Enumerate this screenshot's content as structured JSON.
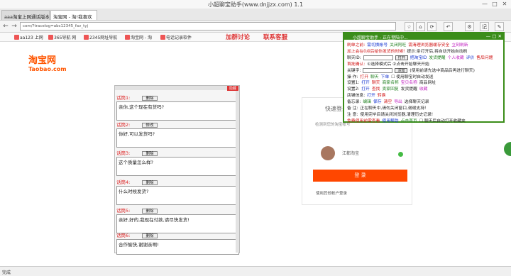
{
  "window": {
    "title": "小超聊宝助手(www.dnjjzx.com) 1.1",
    "controls": [
      "—",
      "□",
      "✕"
    ]
  },
  "tabs": [
    {
      "label": "aaa淘宝上网通话版本号"
    },
    {
      "label": "淘宝网 - 淘!我喜欢"
    }
  ],
  "nav": {
    "back": "←",
    "forward": "→",
    "url": "com/?tracelog=abc12345_fav_tyj",
    "toolbar_icons": [
      "☆",
      "⌂",
      "⟳",
      "↶",
      "⚙",
      "记",
      "✎"
    ]
  },
  "bookmarks": {
    "items": [
      "aa123 上网",
      "365导航 网",
      "2345网址导航",
      "淘宝网 - 淘",
      "电话记录软件"
    ],
    "links": [
      "加群讨论",
      "联系客服"
    ]
  },
  "logo": {
    "cn": "淘宝网",
    "en": "Taobao.com"
  },
  "panel": {
    "close": "隐藏",
    "messages": [
      {
        "label": "话筒1:",
        "button": "删除",
        "text": "亲你,这个现在有货吗?"
      },
      {
        "label": "话筒2:",
        "button": "修改",
        "text": "你好,可以发货吗?"
      },
      {
        "label": "话筒3:",
        "button": "删除",
        "text": "这个质量怎么样?"
      },
      {
        "label": "话筒4:",
        "button": "删除",
        "text": "什么时候发货?"
      },
      {
        "label": "话筒5:",
        "button": "删除",
        "text": "亲好,好的,我现在付款,请尽快发货!"
      },
      {
        "label": "话筒6:",
        "button": "删除",
        "text": "合作愉快,谢谢亲啊!"
      }
    ]
  },
  "login": {
    "heading": "快速登录",
    "sub": "检测到您的淘宝帐号",
    "username": "江都淘宝",
    "button": "登 录",
    "footer": "使用其他帐户登录"
  },
  "helper": {
    "title": "小超聊宝助手 - 正在登陆中...",
    "close": "— □ ✕",
    "rows": [
      [
        {
          "c": "r",
          "t": "刷单之前:"
        },
        {
          "c": "b",
          "t": "需切换帐号"
        },
        {
          "c": "g",
          "t": "关闭阿旺"
        },
        {
          "c": "r",
          "t": "需清理浏览器缓存安全"
        },
        {
          "c": "p",
          "t": "立刻刷新"
        }
      ],
      [
        {
          "c": "r",
          "t": "加上会在0点后给你发货的时候!"
        },
        {
          "c": "k",
          "t": "提示:亲打开后,将自动开始自动刷"
        }
      ],
      [
        {
          "c": "k",
          "t": "聊天ID:"
        },
        {
          "box": true
        },
        {
          "btn": "打开"
        },
        {
          "c": "b",
          "t": "把淘宝ID"
        },
        {
          "c": "g",
          "t": "发货提醒"
        },
        {
          "c": "p",
          "t": "个人收藏"
        },
        {
          "c": "b",
          "t": "评价"
        },
        {
          "c": "r",
          "t": "售后问题"
        }
      ],
      [
        {
          "c": "r",
          "t": "首批确认:"
        },
        {
          "c": "k",
          "t": "①选择模式后 ②点击开始聊天开始"
        }
      ],
      [
        {
          "c": "k",
          "t": "关键字:"
        },
        {
          "box": true
        },
        {
          "btn": "添加"
        },
        {
          "c": "k",
          "t": "(使用前请先选中商品后再进行聊天)"
        }
      ],
      [
        {
          "c": "k",
          "t": "操 作:"
        },
        {
          "c": "r",
          "t": "打开"
        },
        {
          "c": "g",
          "t": "聊天"
        },
        {
          "c": "b",
          "t": "下单"
        },
        {
          "c": "k",
          "t": "☐ 使用聊宝时自动发送"
        }
      ],
      [
        {
          "c": "k",
          "t": "设置1:"
        },
        {
          "c": "b",
          "t": "打开"
        },
        {
          "c": "r",
          "t": "聊天"
        },
        {
          "c": "g",
          "t": "商家名称"
        },
        {
          "c": "p",
          "t": "宝贝名称"
        },
        {
          "c": "k",
          "t": "商品网址"
        }
      ],
      [
        {
          "c": "k",
          "t": "设置2:"
        },
        {
          "c": "b",
          "t": "打开"
        },
        {
          "c": "r",
          "t": "查找"
        },
        {
          "c": "g",
          "t": "卖家回复"
        },
        {
          "c": "k",
          "t": "发货提醒"
        },
        {
          "c": "p",
          "t": "收藏"
        }
      ],
      [
        {
          "c": "k",
          "t": "店铺信息:"
        },
        {
          "c": "b",
          "t": "打开"
        },
        {
          "c": "r",
          "t": "转换"
        }
      ],
      [
        {
          "c": "k",
          "t": "备忘录:"
        },
        {
          "c": "g",
          "t": "编辑"
        },
        {
          "c": "b",
          "t": "保存"
        },
        {
          "c": "r",
          "t": "清空"
        },
        {
          "c": "p",
          "t": "导出"
        },
        {
          "c": "k",
          "t": "选择聊天记录"
        }
      ],
      [
        {
          "c": "k",
          "t": "备 注:"
        },
        {
          "c": "k",
          "t": "正在聊天中,请勿关闭窗口,谢谢支持!"
        }
      ],
      [
        {
          "c": "k",
          "t": "注 意:"
        },
        {
          "c": "k",
          "t": "使用完毕后请关闭浏览器,清理历史记录!"
        }
      ],
      [
        {
          "c": "r",
          "t": "免费使用前需查看"
        },
        {
          "c": "b",
          "t": "使用帮助"
        },
        {
          "c": "g",
          "t": "点击首页"
        },
        {
          "c": "k",
          "t": "☐ 聊天后自动打开收藏夹"
        }
      ]
    ]
  },
  "status": {
    "text": "完成"
  },
  "colors": {
    "taobao_orange": "#ff5500",
    "helper_green": "#3b8d1a",
    "login_button": "#ff4700"
  }
}
